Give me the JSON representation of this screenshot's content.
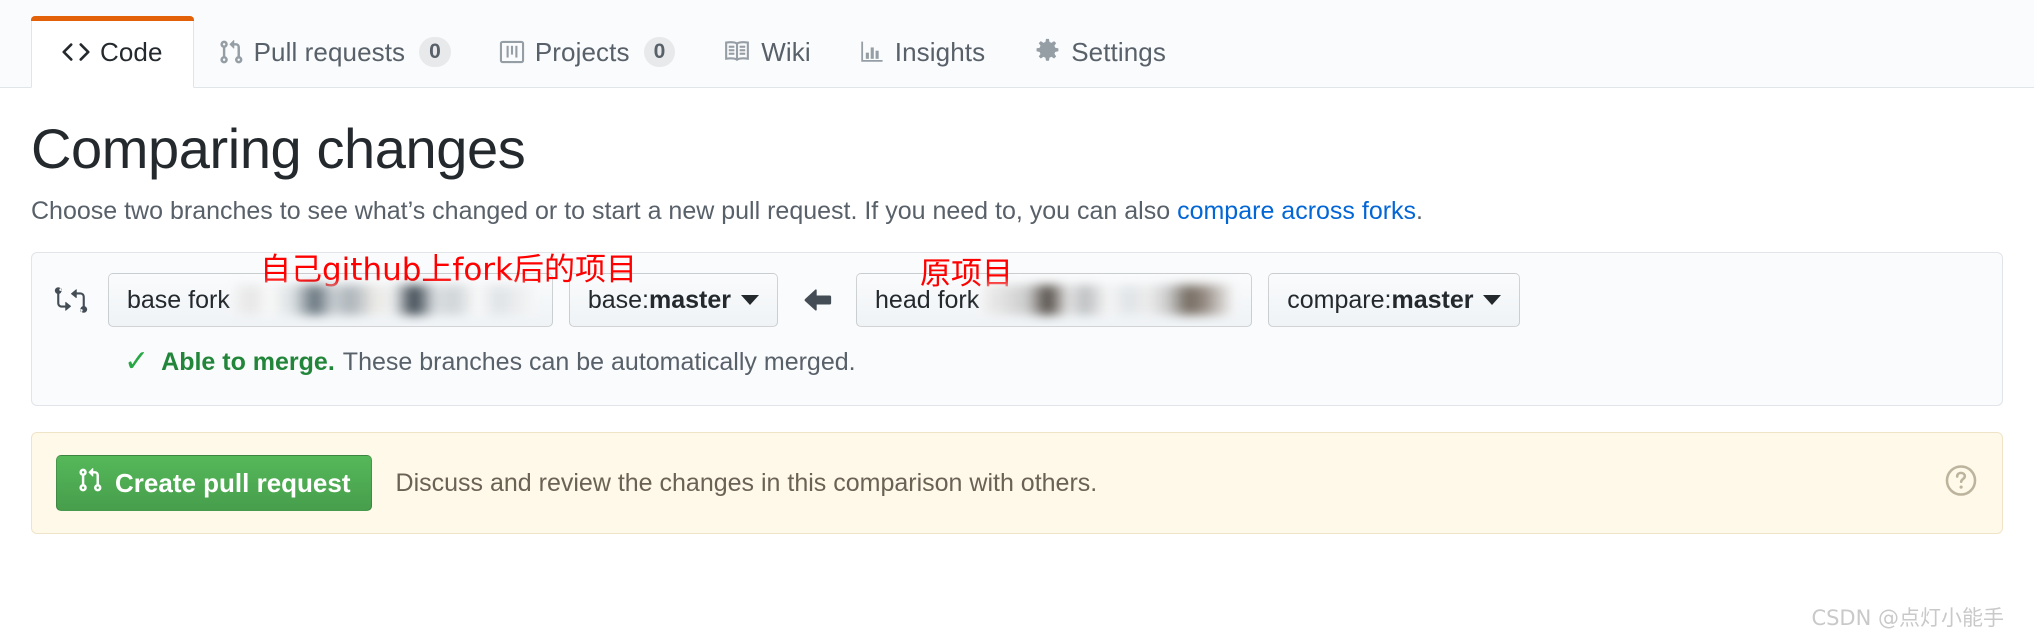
{
  "tabs": [
    {
      "label": "Code",
      "icon": "code-icon",
      "count": null,
      "selected": true
    },
    {
      "label": "Pull requests",
      "icon": "git-pull-request-icon",
      "count": "0",
      "selected": false
    },
    {
      "label": "Projects",
      "icon": "project-board-icon",
      "count": "0",
      "selected": false
    },
    {
      "label": "Wiki",
      "icon": "book-icon",
      "count": null,
      "selected": false
    },
    {
      "label": "Insights",
      "icon": "graph-icon",
      "count": null,
      "selected": false
    },
    {
      "label": "Settings",
      "icon": "gear-icon",
      "count": null,
      "selected": false
    }
  ],
  "header": {
    "title": "Comparing changes",
    "subtitle_before": "Choose two branches to see what’s changed or to start a new pull request. If you need to, you can also ",
    "subtitle_link": "compare across forks",
    "subtitle_after": "."
  },
  "compare": {
    "base_fork_label": "base fork",
    "base_branch_prefix": "base: ",
    "base_branch": "master",
    "head_fork_label": "head fork",
    "compare_branch_prefix": "compare: ",
    "compare_branch": "master",
    "annotation_base": "自己github上fork后的项目",
    "annotation_head": "原项目",
    "merge_check": "✓",
    "merge_status": "Able to merge.",
    "merge_detail": "These branches can be automatically merged."
  },
  "flash": {
    "create_button": "Create pull request",
    "message": "Discuss and review the changes in this comparison with others.",
    "help_icon": "question-icon"
  },
  "watermark": "CSDN @点灯小能手",
  "colors": {
    "accent_orange": "#e36209",
    "link_blue": "#0366d6",
    "success_green": "#22863a",
    "button_green": "#55b859",
    "annotation_red": "#ff0000",
    "flash_bg": "#fff9ea"
  }
}
